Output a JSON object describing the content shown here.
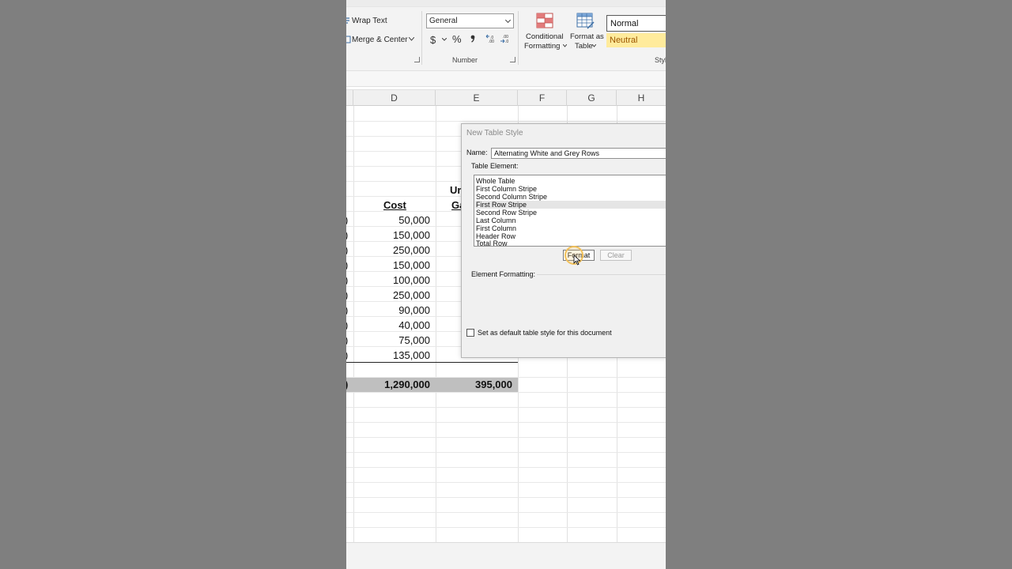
{
  "ribbon": {
    "wrap_text": "Wrap Text",
    "merge_center": "Merge & Center",
    "number_format_value": "General",
    "number_group_label": "Number",
    "currency_symbol": "$",
    "percent_symbol": "%",
    "comma_symbol": "\u0019",
    "conditional_formatting_line1": "Conditional",
    "conditional_formatting_line2": "Formatting",
    "format_as_table_line1": "Format as",
    "format_as_table_line2": "Table",
    "style_normal": "Normal",
    "style_neutral": "Neutral",
    "styles_group_label_partial": "Styl"
  },
  "columns": [
    "D",
    "E",
    "F",
    "G",
    "H"
  ],
  "sheet": {
    "header_partial_top": "Ur",
    "header_partial_bottom": "Ga",
    "cost_header": "Cost",
    "cost_values": [
      "50,000",
      "150,000",
      "250,000",
      "150,000",
      "100,000",
      "250,000",
      "90,000",
      "40,000",
      "75,000",
      "135,000"
    ],
    "left_edge_fragment": ")",
    "total_cost": "1,290,000",
    "total_gain": "395,000",
    "total_left_fragment": ")"
  },
  "dialog": {
    "title": "New Table Style",
    "name_label": "Name:",
    "name_value": "Alternating White and Grey Rows",
    "table_element_label": "Table Element:",
    "elements": [
      "Whole Table",
      "First Column Stripe",
      "Second Column Stripe",
      "First Row Stripe",
      "Second Row Stripe",
      "Last Column",
      "First Column",
      "Header Row",
      "Total Row"
    ],
    "selected_index": 3,
    "format_button": "Format",
    "clear_button": "Clear",
    "element_formatting_label": "Element Formatting:",
    "default_checkbox_label": "Set as default table style for this document",
    "default_checked": false
  },
  "colors": {
    "neutral_fill": "#ffeb9c",
    "neutral_text": "#9c5700",
    "total_band": "#bfbfbf",
    "click_highlight": "#f3c15a"
  }
}
